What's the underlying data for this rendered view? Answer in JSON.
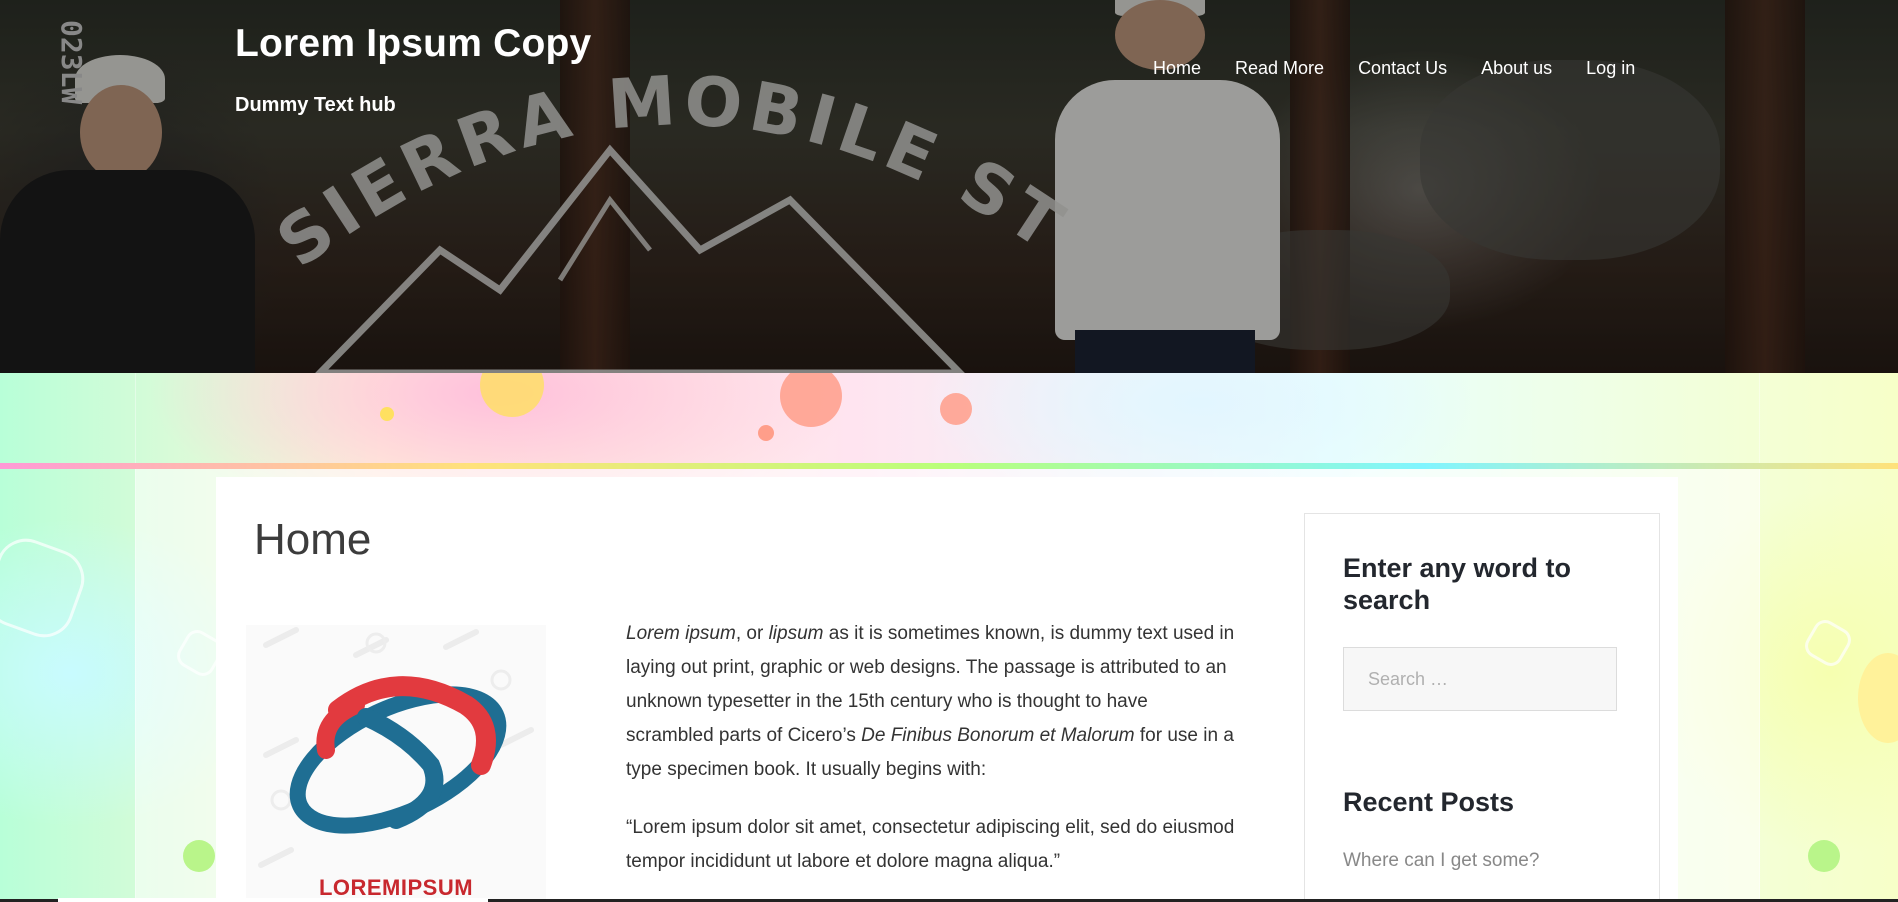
{
  "header": {
    "site_title": "Lorem Ipsum Copy",
    "tagline": "Dummy Text hub",
    "hero_sign_text": "SIERRA MOBILE STORAGE",
    "hero_post_text": "023LW"
  },
  "nav": {
    "items": [
      {
        "label": "Home"
      },
      {
        "label": "Read More"
      },
      {
        "label": "Contact Us"
      },
      {
        "label": "About us"
      },
      {
        "label": "Log in"
      }
    ]
  },
  "main": {
    "page_title": "Home",
    "logo_caption": "LOREMIPSUM",
    "paragraph1": {
      "em1": "Lorem ipsum",
      "t1": ", or ",
      "em2": "lipsum",
      "t2": " as it is sometimes known, is dummy text used in laying out print, graphic or web designs. The passage is attributed to an unknown typesetter in the 15th century who is thought to have scrambled parts of Cicero’s ",
      "em3": "De Finibus Bonorum et Malorum",
      "t3": " for use in a type specimen book. It usually begins with:"
    },
    "paragraph2": "“Lorem ipsum dolor sit amet, consectetur adipiscing elit, sed do eiusmod tempor incididunt ut labore et dolore magna aliqua.”"
  },
  "sidebar": {
    "search_title": "Enter any word to search",
    "search_placeholder": "Search …",
    "recent_title": "Recent Posts",
    "recent_posts": [
      {
        "label": "Where can I get some?"
      }
    ]
  },
  "colors": {
    "logo_red": "#e23a3f",
    "logo_blue": "#1f6e93",
    "title_text": "#3c3c3c"
  }
}
